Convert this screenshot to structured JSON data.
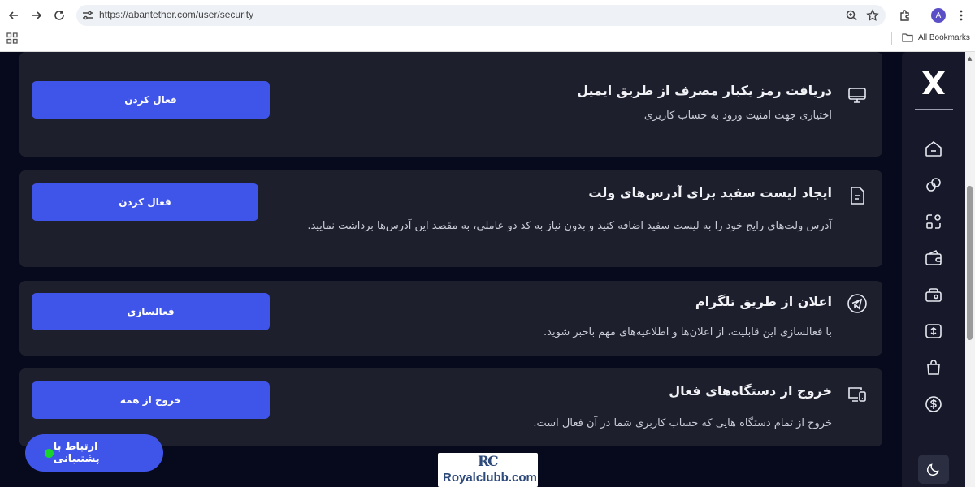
{
  "browser": {
    "url": "https://abantether.com/user/security",
    "avatar_letter": "A",
    "bookmarks_label": "All Bookmarks"
  },
  "cards": [
    {
      "icon": "monitor-icon",
      "title": "دریافت رمز یکبار مصرف از طریق ایمیل",
      "description": "اختیاری جهت امنیت ورود به حساب کاربری",
      "button": "فعال کردن"
    },
    {
      "icon": "document-icon",
      "title": "ایجاد لیست سفید برای آدرس‌های ولت",
      "description": "آدرس ولت‌های رایج خود را به لیست سفید اضافه کنید و بدون نیاز به کد دو عاملی، به مقصد این آدرس‌ها برداشت نمایید.",
      "button": "فعال کردن"
    },
    {
      "icon": "telegram-icon",
      "title": "اعلان از طریق تلگرام",
      "description": "با فعالسازی این قابلیت، از اعلان‌ها و اطلاعیه‌های مهم باخبر شوید.",
      "button": "فعالسازی"
    },
    {
      "icon": "devices-icon",
      "title": "خروج از دستگاه‌های فعال",
      "description": "خروج از تمام دستگاه هایی که حساب کاربری شما در آن فعال است.",
      "button": "خروج از همه"
    }
  ],
  "sidebar": {
    "logo": "X",
    "items": [
      "home-icon",
      "exchange-icon",
      "transfer-icon",
      "wallet-icon",
      "piggy-bank-icon",
      "market-icon",
      "shopping-bag-icon",
      "dollar-icon"
    ],
    "theme": "moon-icon"
  },
  "support": {
    "label": "ارتباط با پشتیبانی",
    "status_color": "#18d42b"
  },
  "watermark": {
    "logo": "RC",
    "text": "Royalclubb.com"
  },
  "colors": {
    "accent": "#3f54e8",
    "background": "#07091c",
    "card": "#1d1f2c"
  }
}
